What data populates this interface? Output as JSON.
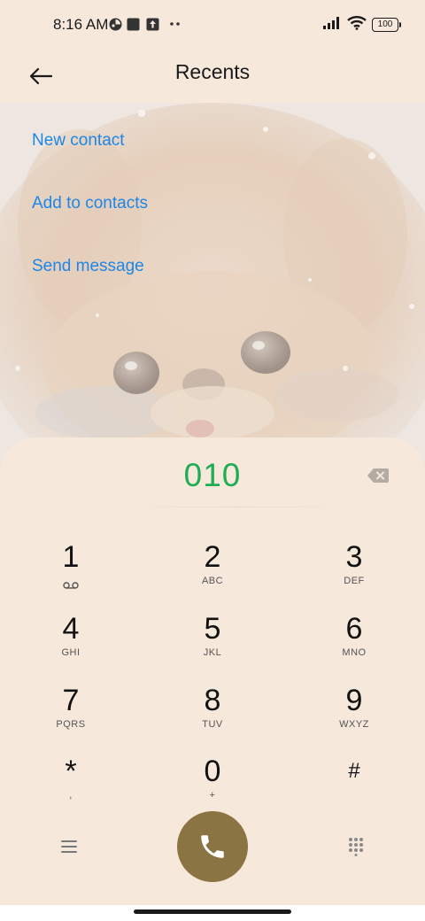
{
  "status_bar": {
    "time": "8:16 AM",
    "battery": "100",
    "icons": [
      "app-notification-icon",
      "square-notification-icon",
      "upload-icon",
      "more-dots-icon",
      "signal-icon",
      "wifi-icon",
      "battery-icon"
    ]
  },
  "header": {
    "title": "Recents",
    "back_icon": "arrow-left-icon"
  },
  "actions": {
    "new_contact": "New contact",
    "add_to_contacts": "Add to contacts",
    "send_message": "Send message"
  },
  "dialer": {
    "number": "010",
    "keys": [
      {
        "digit": "1",
        "letters": ""
      },
      {
        "digit": "2",
        "letters": "ABC"
      },
      {
        "digit": "3",
        "letters": "DEF"
      },
      {
        "digit": "4",
        "letters": "GHI"
      },
      {
        "digit": "5",
        "letters": "JKL"
      },
      {
        "digit": "6",
        "letters": "MNO"
      },
      {
        "digit": "7",
        "letters": "PQRS"
      },
      {
        "digit": "8",
        "letters": "TUV"
      },
      {
        "digit": "9",
        "letters": "WXYZ"
      },
      {
        "digit": "*",
        "letters": ","
      },
      {
        "digit": "0",
        "letters": "+"
      },
      {
        "digit": "#",
        "letters": ""
      }
    ]
  },
  "colors": {
    "background": "#f6e8db",
    "link": "#1e86e8",
    "number": "#1fad53",
    "call_button": "#8a7444"
  }
}
